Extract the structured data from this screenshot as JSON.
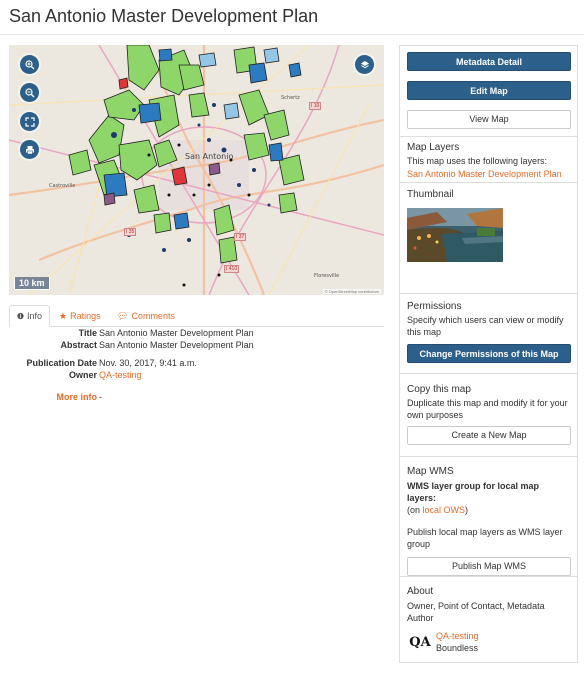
{
  "page": {
    "title": "San Antonio Master Development Plan"
  },
  "map": {
    "scale_label": "10 km",
    "attribution": "© OpenStreetMap contributors",
    "city_label": "San Antonio",
    "place_labels": [
      "Castroville",
      "Schertz",
      "Floresville"
    ],
    "road_shields": [
      "I 35",
      "I 10",
      "I 37",
      "I 410",
      "I 10\nUS 90\nTX 130"
    ],
    "controls": [
      "zoom-in",
      "zoom-out",
      "fullscreen",
      "print",
      "layers"
    ]
  },
  "tabs": [
    {
      "label": "Info",
      "icon": "info-icon",
      "active": true
    },
    {
      "label": "Ratings",
      "icon": "star-icon",
      "active": false
    },
    {
      "label": "Comments",
      "icon": "comment-icon",
      "active": false
    }
  ],
  "info": {
    "title_label": "Title",
    "title_value": "San Antonio Master Development Plan",
    "abstract_label": "Abstract",
    "abstract_value": "San Antonio Master Development Plan",
    "pubdate_label": "Publication Date",
    "pubdate_value": "Nov. 30, 2017, 9:41 a.m.",
    "owner_label": "Owner",
    "owner_value": "QA-testing",
    "more_label": "More info",
    "more_value": "-"
  },
  "sidebar": {
    "metadata_button": "Metadata Detail",
    "edit_button": "Edit Map",
    "view_button": "View Map",
    "layers_title": "Map Layers",
    "layers_text": "This map uses the following layers:",
    "layer_link": "San Antonio Master Development Plan",
    "thumbnail_title": "Thumbnail",
    "permissions_title": "Permissions",
    "permissions_text": "Specify which users can view or modify this map",
    "permissions_button": "Change Permissions of this Map",
    "copy_title": "Copy this map",
    "copy_text": "Duplicate this map and modify it for your own purposes",
    "copy_button": "Create a New Map",
    "wms_title": "Map WMS",
    "wms_bold": "WMS layer group for local map layers:",
    "wms_on_prefix": "(on ",
    "wms_on_link": "local OWS",
    "wms_on_suffix": ")",
    "wms_text": "Publish local map layers as WMS layer group",
    "wms_button": "Publish Map WMS",
    "about_title": "About",
    "about_roles": "Owner, Point of Contact, Metadata Author",
    "about_user": "QA-testing",
    "about_org": "Boundless",
    "about_logo_text": "QA"
  },
  "colors": {
    "accent": "#e06b2a",
    "primary": "#2c5f8a",
    "border": "#dddddd"
  }
}
